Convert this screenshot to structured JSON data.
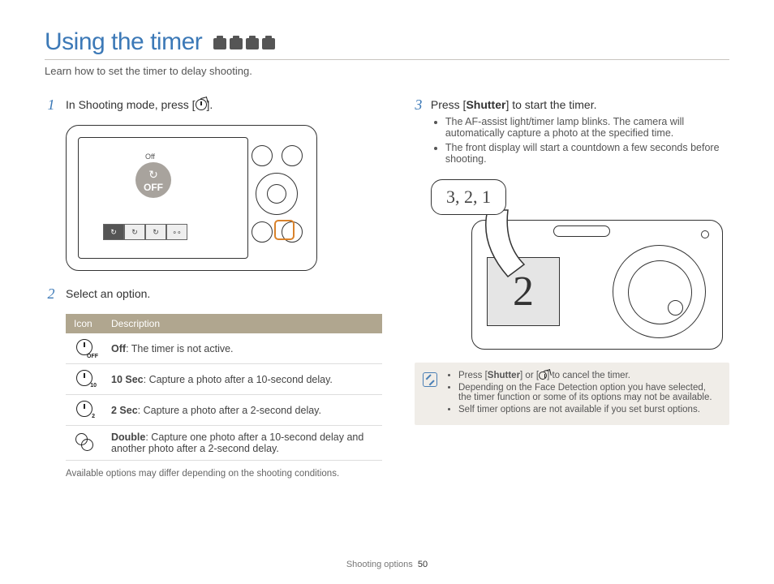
{
  "title": "Using the timer",
  "subtitle": "Learn how to set the timer to delay shooting.",
  "steps": {
    "s1": {
      "num": "1",
      "pre": "In Shooting mode, press [",
      "post": "]."
    },
    "s2": {
      "num": "2",
      "text": "Select an option."
    },
    "s3": {
      "num": "3",
      "pre": "Press [",
      "bold": "Shutter",
      "post": "] to start the timer."
    }
  },
  "camera_back": {
    "off_small": "Off",
    "off_big": "OFF"
  },
  "table": {
    "head_icon": "Icon",
    "head_desc": "Description",
    "rows": [
      {
        "label": "Off",
        "text": ": The timer is not active."
      },
      {
        "label": "10 Sec",
        "text": ": Capture a photo after a 10-second delay."
      },
      {
        "label": "2 Sec",
        "text": ": Capture a photo after a 2-second delay."
      },
      {
        "label": "Double",
        "text": ": Capture one photo after a 10-second delay and another photo after a 2-second delay."
      }
    ],
    "footnote": "Available options may differ depending on the shooting conditions."
  },
  "step3_bullets": [
    "The AF-assist light/timer lamp blinks. The camera will automatically capture a photo at the specified time.",
    "The front display will start a countdown a few seconds before shooting."
  ],
  "speech": "3, 2, 1",
  "front_display": "2",
  "infobox": {
    "b1_pre": "Press [",
    "b1_bold": "Shutter",
    "b1_mid": "] or [",
    "b1_post": "] to cancel the timer.",
    "b2": "Depending on the Face Detection option you have selected, the timer function or some of its options may not be available.",
    "b3": "Self timer options are not available if you set burst options."
  },
  "footer": {
    "section": "Shooting options",
    "page": "50"
  }
}
